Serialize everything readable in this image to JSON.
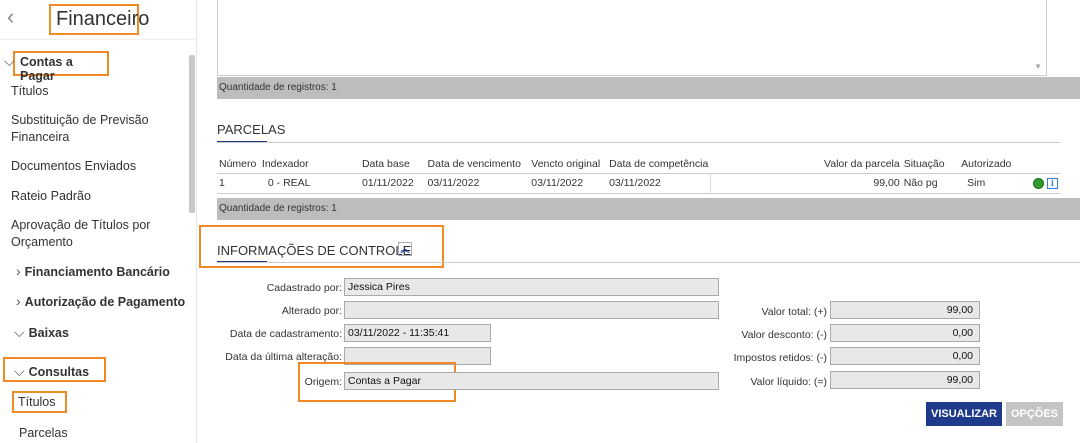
{
  "sidebar": {
    "title": "Financeiro",
    "back_icon": "chevron-left-icon",
    "group_contas": "Contas a Pagar",
    "items_contas": [
      "Títulos",
      "Substituição de Previsão Financeira",
      "Documentos Enviados",
      "Rateio Padrão",
      "Aprovação de Títulos por Orçamento"
    ],
    "group_financiamento": "Financiamento Bancário",
    "group_autorizacao": "Autorização de Pagamento",
    "group_baixas": "Baixas",
    "group_consultas": "Consultas",
    "items_consultas": [
      "Títulos",
      "Parcelas"
    ]
  },
  "top_list": {
    "count_label": "Quantidade de registros: 1"
  },
  "parcelas": {
    "title": "PARCELAS",
    "columns": [
      "Número",
      "Indexador",
      "Data base",
      "Data de vencimento",
      "Vencto original",
      "Data de competência",
      "Valor da parcela",
      "Situação",
      "Autorizado"
    ],
    "rows": [
      {
        "numero": "1",
        "indexador": "0 - REAL",
        "data_base": "01/11/2022",
        "vencimento": "03/11/2022",
        "vencto_original": "03/11/2022",
        "competencia": "03/11/2022",
        "valor": "99,00",
        "situacao": "Não pg",
        "autorizado": "Sim"
      }
    ],
    "count_label": "Quantidade de registros: 1"
  },
  "controle": {
    "title": "INFORMAÇÕES DE CONTROLE",
    "cadastrado_label": "Cadastrado por:",
    "cadastrado_value": "Jessica Pires",
    "alterado_label": "Alterado por:",
    "alterado_value": "",
    "data_cad_label": "Data de cadastramento:",
    "data_cad_value": "03/11/2022 - 11:35:41",
    "data_alt_label": "Data da última alteração:",
    "data_alt_value": "",
    "origem_label": "Origem:",
    "origem_value": "Contas a Pagar",
    "valor_total_label": "Valor total: (+)",
    "valor_total_value": "99,00",
    "valor_desconto_label": "Valor desconto: (-)",
    "valor_desconto_value": "0,00",
    "impostos_label": "Impostos retidos: (-)",
    "impostos_value": "0,00",
    "valor_liquido_label": "Valor líquido: (=)",
    "valor_liquido_value": "99,00"
  },
  "buttons": {
    "visualizar": "VISUALIZAR",
    "opcoes": "OPÇÕES"
  },
  "colors": {
    "highlight": "#f08a24",
    "primary": "#1f3a8a",
    "bar": "#bdbdbd"
  }
}
